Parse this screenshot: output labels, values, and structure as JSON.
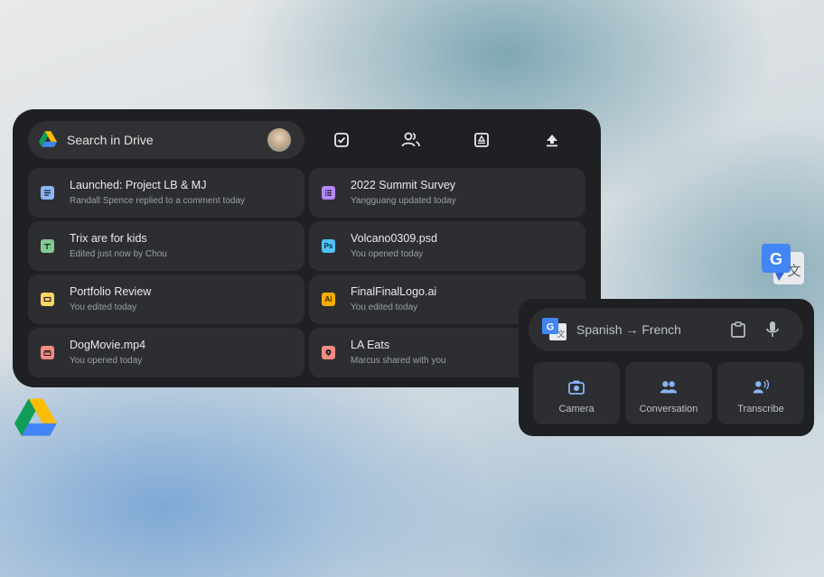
{
  "drive_widget": {
    "search_placeholder": "Search in Drive",
    "quick_actions": [
      "checkbox-icon",
      "shared-people-icon",
      "drive-image-icon",
      "upload-icon"
    ],
    "files": [
      {
        "title": "Launched: Project LB & MJ",
        "subtitle": "Randall Spence replied to a comment today",
        "icon": "docs-icon",
        "color": "#8ab4f8"
      },
      {
        "title": "2022 Summit Survey",
        "subtitle": "Yangguang updated today",
        "icon": "forms-icon",
        "color": "#b388ff"
      },
      {
        "title": "Trix are for kids",
        "subtitle": "Edited just now by Chou",
        "icon": "sheets-icon",
        "color": "#81c995"
      },
      {
        "title": "Volcano0309.psd",
        "subtitle": "You opened today",
        "icon": "photoshop-icon",
        "color": "#4fc3f7"
      },
      {
        "title": "Portfolio Review",
        "subtitle": "You edited today",
        "icon": "slides-icon",
        "color": "#fdd663"
      },
      {
        "title": "FinalFinalLogo.ai",
        "subtitle": "You edited today",
        "icon": "illustrator-icon",
        "color": "#f9ab00"
      },
      {
        "title": "DogMovie.mp4",
        "subtitle": "You opened today",
        "icon": "video-icon",
        "color": "#f28b82"
      },
      {
        "title": "LA Eats",
        "subtitle": "Marcus shared with you",
        "icon": "maps-icon",
        "color": "#f28b82"
      }
    ]
  },
  "translate_widget": {
    "language_pair": "Spanish → French",
    "buttons": [
      {
        "label": "Camera",
        "icon": "camera-icon"
      },
      {
        "label": "Conversation",
        "icon": "conversation-icon"
      },
      {
        "label": "Transcribe",
        "icon": "transcribe-icon"
      }
    ]
  },
  "colors": {
    "widget_bg": "#1f2023",
    "card_bg": "#2d2e31",
    "accent_blue": "#8ab4f8"
  }
}
